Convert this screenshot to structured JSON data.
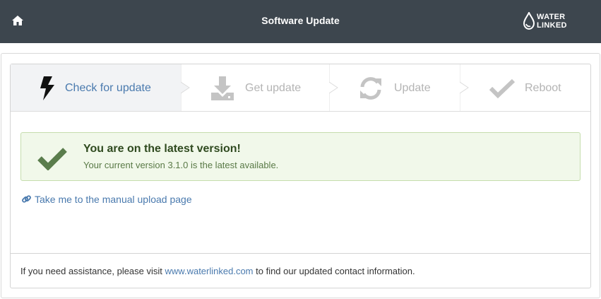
{
  "header": {
    "title": "Software Update",
    "home_icon": "home-icon",
    "logo": {
      "line1": "WATER",
      "line2": "LINKED"
    }
  },
  "steps": [
    {
      "label": "Check for update",
      "icon": "bolt-icon",
      "active": true
    },
    {
      "label": "Get update",
      "icon": "download-icon",
      "active": false
    },
    {
      "label": "Update",
      "icon": "refresh-icon",
      "active": false
    },
    {
      "label": "Reboot",
      "icon": "checkmark-icon",
      "active": false
    }
  ],
  "alert": {
    "title": "You are on the latest version!",
    "message": "Your current version 3.1.0 is the latest available.",
    "icon": "checkmark-icon"
  },
  "manual_link": {
    "label": "Take me to the manual upload page",
    "icon": "link-icon"
  },
  "footer": {
    "prefix": "If you need assistance, please visit ",
    "link": "www.waterlinked.com",
    "suffix": " to find our updated contact information."
  },
  "colors": {
    "topbar": "#3d464e",
    "accent": "#4a7aae",
    "success_bg": "#f1f8ea",
    "success_icon": "#5a7d4c",
    "inactive": "#b4b4b4"
  }
}
